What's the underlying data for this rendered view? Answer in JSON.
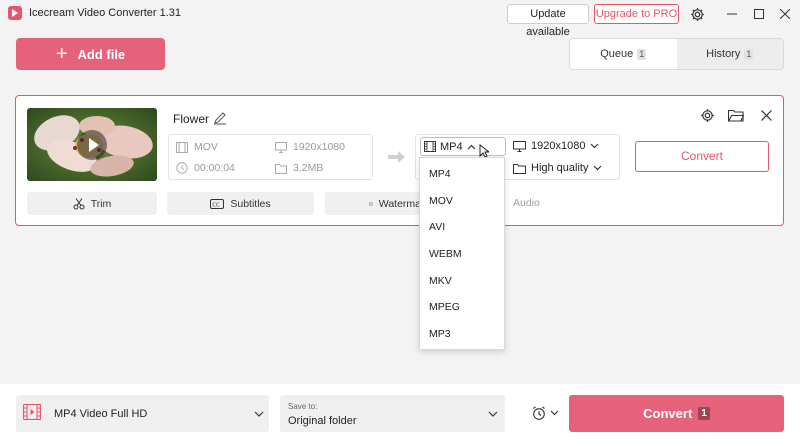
{
  "app": {
    "title": "Icecream Video Converter 1.31"
  },
  "titlebar": {
    "update_label": "Update available",
    "pro_label": "Upgrade to PRO"
  },
  "toolbar": {
    "add_file_label": "Add file"
  },
  "tabs": [
    {
      "label": "Queue",
      "count": "1",
      "active": true
    },
    {
      "label": "History",
      "count": "1",
      "active": false
    }
  ],
  "file": {
    "name": "Flower",
    "source": {
      "format": "MOV",
      "resolution": "1920x1080",
      "duration": "00:00:04",
      "size": "3.2MB"
    },
    "target": {
      "format": "MP4",
      "resolution": "1920x1080",
      "quality": "High quality"
    },
    "convert_label": "Convert",
    "tools": {
      "trim": "Trim",
      "subtitles": "Subtitles",
      "watermark": "Waterma",
      "audio": "Audio"
    }
  },
  "format_dropdown": [
    "MP4",
    "MOV",
    "AVI",
    "WEBM",
    "MKV",
    "MPEG",
    "MP3"
  ],
  "bottom": {
    "preset": "MP4 Video Full HD",
    "save_to_caption": "Save to:",
    "save_to_value": "Original folder",
    "convert_label": "Convert",
    "convert_count": "1"
  },
  "colors": {
    "accent": "#e6627a",
    "accent_border": "#e6556b"
  }
}
